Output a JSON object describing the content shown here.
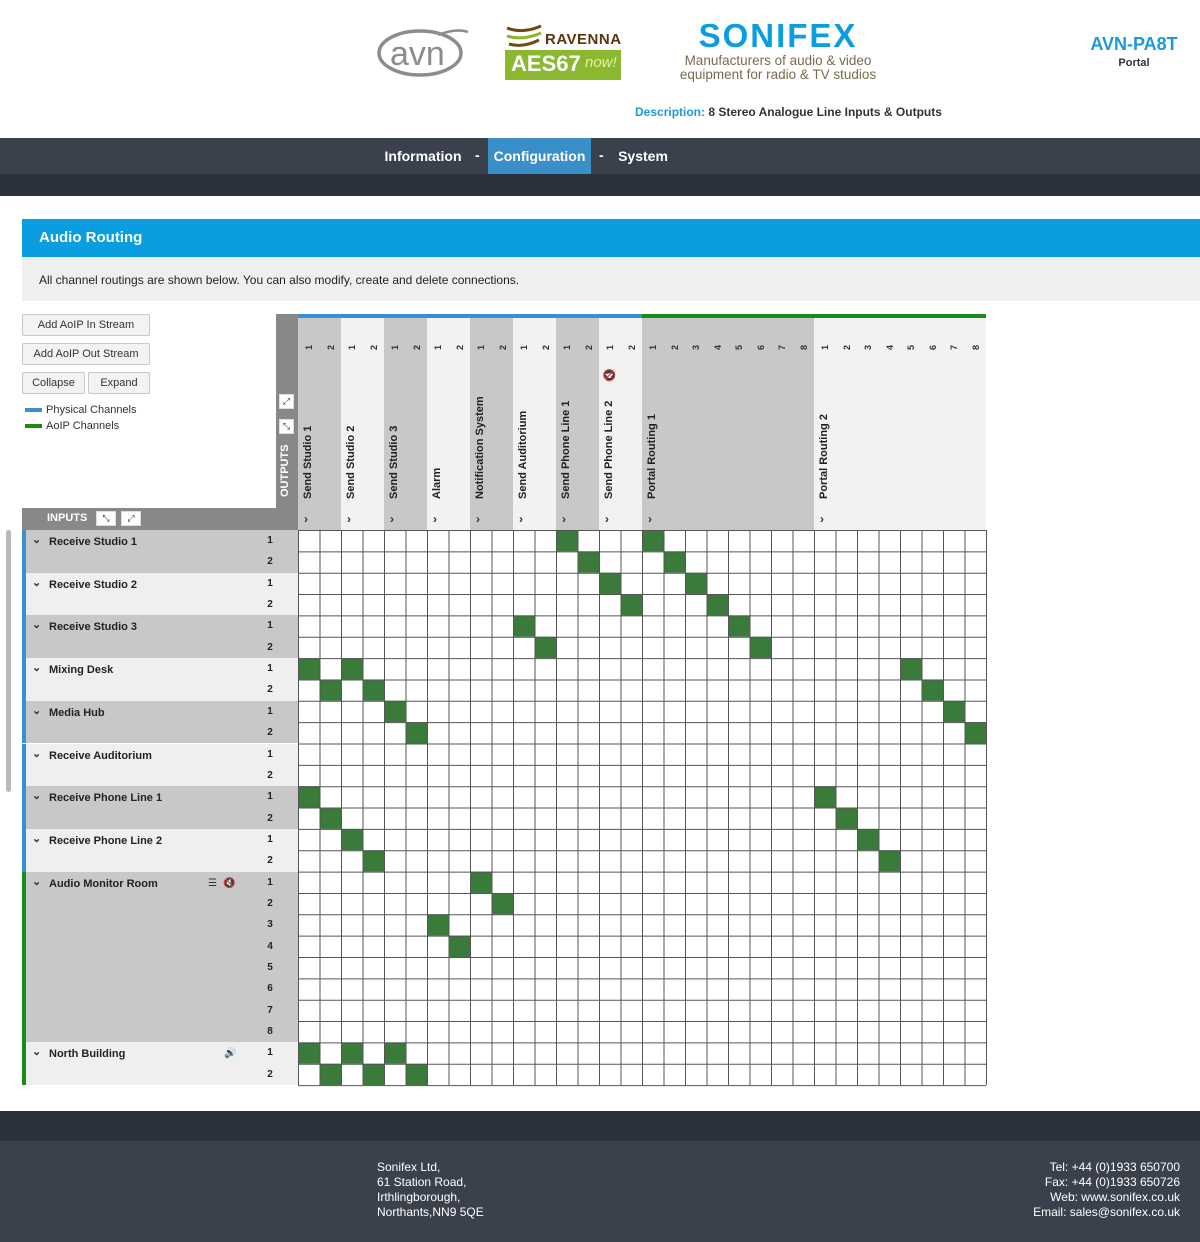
{
  "header": {
    "logo_avn": "avn",
    "logo_ravenna": "RAVENNA",
    "logo_aes": "AES67",
    "logo_now": "now!",
    "brand_name": "SONIFEX",
    "brand_tag_1": "Manufacturers of audio & video",
    "brand_tag_2": "equipment for radio & TV studios",
    "model": "AVN-PA8T",
    "model_sub": "Portal",
    "description_label": "Description:",
    "description_value": "8 Stereo Analogue Line Inputs & Outputs"
  },
  "nav": {
    "items": [
      "Information",
      "Configuration",
      "System"
    ],
    "separator": "-",
    "active": "Configuration"
  },
  "panel": {
    "title": "Audio Routing",
    "info": "All channel routings are shown below. You can also modify, create and delete connections."
  },
  "controls": {
    "add_in": "Add AoIP In Stream",
    "add_out": "Add AoIP Out Stream",
    "collapse": "Collapse",
    "expand": "Expand",
    "legend_physical": "Physical Channels",
    "legend_aoip": "AoIP Channels",
    "legend_physical_color": "#3b8fd0",
    "legend_aoip_color": "#1a8a1a"
  },
  "matrix": {
    "outputs_label": "OUTPUTS",
    "inputs_label": "INPUTS",
    "cell_on_color": "#3a7a3a",
    "outputs": [
      {
        "name": "Send Studio 1",
        "channels": [
          "1",
          "2"
        ],
        "type": "physical"
      },
      {
        "name": "Send Studio 2",
        "channels": [
          "1",
          "2"
        ],
        "type": "physical"
      },
      {
        "name": "Send Studio 3",
        "channels": [
          "1",
          "2"
        ],
        "type": "physical"
      },
      {
        "name": "Alarm",
        "channels": [
          "1",
          "2"
        ],
        "type": "physical"
      },
      {
        "name": "Notification System",
        "channels": [
          "1",
          "2"
        ],
        "type": "physical"
      },
      {
        "name": "Send Auditorium",
        "channels": [
          "1",
          "2"
        ],
        "type": "physical"
      },
      {
        "name": "Send Phone Line 1",
        "channels": [
          "1",
          "2"
        ],
        "type": "physical"
      },
      {
        "name": "Send Phone Line 2",
        "channels": [
          "1",
          "2"
        ],
        "type": "physical",
        "muted": true
      },
      {
        "name": "Portal Routing 1",
        "channels": [
          "1",
          "2",
          "3",
          "4",
          "5",
          "6",
          "7",
          "8"
        ],
        "type": "aoip"
      },
      {
        "name": "Portal Routing 2",
        "channels": [
          "1",
          "2",
          "3",
          "4",
          "5",
          "6",
          "7",
          "8"
        ],
        "type": "aoip"
      }
    ],
    "inputs": [
      {
        "name": "Receive Studio 1",
        "channels": [
          "1",
          "2"
        ],
        "type": "physical"
      },
      {
        "name": "Receive Studio 2",
        "channels": [
          "1",
          "2"
        ],
        "type": "physical"
      },
      {
        "name": "Receive Studio 3",
        "channels": [
          "1",
          "2"
        ],
        "type": "physical"
      },
      {
        "name": "Mixing Desk",
        "channels": [
          "1",
          "2"
        ],
        "type": "physical"
      },
      {
        "name": "Media Hub",
        "channels": [
          "1",
          "2"
        ],
        "type": "physical"
      },
      {
        "name": "Receive Auditorium",
        "channels": [
          "1",
          "2"
        ],
        "type": "physical"
      },
      {
        "name": "Receive Phone Line 1",
        "channels": [
          "1",
          "2"
        ],
        "type": "physical"
      },
      {
        "name": "Receive Phone Line 2",
        "channels": [
          "1",
          "2"
        ],
        "type": "physical"
      },
      {
        "name": "Audio Monitor Room",
        "channels": [
          "1",
          "2",
          "3",
          "4",
          "5",
          "6",
          "7",
          "8"
        ],
        "type": "aoip",
        "icons": "settings-mute"
      },
      {
        "name": "North Building",
        "channels": [
          "1",
          "2"
        ],
        "type": "aoip",
        "icons": "speaker"
      }
    ],
    "connections": [
      [
        0,
        12
      ],
      [
        0,
        16
      ],
      [
        1,
        13
      ],
      [
        1,
        17
      ],
      [
        2,
        14
      ],
      [
        2,
        18
      ],
      [
        3,
        15
      ],
      [
        3,
        19
      ],
      [
        4,
        10
      ],
      [
        4,
        20
      ],
      [
        5,
        11
      ],
      [
        5,
        21
      ],
      [
        6,
        0
      ],
      [
        6,
        2
      ],
      [
        6,
        28
      ],
      [
        7,
        1
      ],
      [
        7,
        3
      ],
      [
        7,
        29
      ],
      [
        8,
        4
      ],
      [
        8,
        30
      ],
      [
        9,
        5
      ],
      [
        9,
        31
      ],
      [
        12,
        0
      ],
      [
        12,
        24
      ],
      [
        13,
        1
      ],
      [
        13,
        25
      ],
      [
        14,
        2
      ],
      [
        14,
        26
      ],
      [
        15,
        3
      ],
      [
        15,
        27
      ],
      [
        16,
        8
      ],
      [
        17,
        9
      ],
      [
        18,
        6
      ],
      [
        19,
        7
      ],
      [
        24,
        0
      ],
      [
        24,
        2
      ],
      [
        24,
        4
      ],
      [
        25,
        1
      ],
      [
        25,
        3
      ],
      [
        25,
        5
      ]
    ]
  },
  "footer": {
    "address": [
      "Sonifex Ltd,",
      "61 Station Road,",
      "Irthlingborough,",
      "Northants,NN9 5QE"
    ],
    "contact": [
      "Tel: +44 (0)1933 650700",
      "Fax: +44 (0)1933 650726",
      "Web: www.sonifex.co.uk",
      "Email: sales@sonifex.co.uk"
    ]
  }
}
